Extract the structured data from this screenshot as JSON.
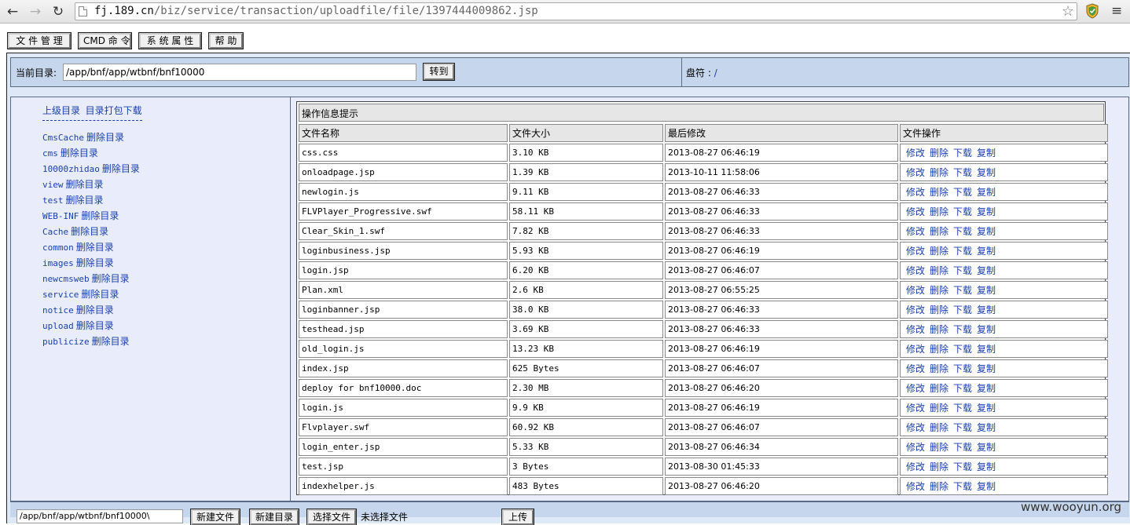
{
  "browser": {
    "url_host": "fj.189.cn",
    "url_path": "/biz/service/transaction/uploadfile/file/1397444009862.jsp",
    "icons": [
      "back-icon",
      "forward-icon",
      "reload-icon",
      "page-icon",
      "star-icon",
      "shield-icon",
      "menu-icon"
    ]
  },
  "top_menu": {
    "file_manage": "文 件 管 理",
    "cmd": "CMD 命 令",
    "sys_attr": "系 统 属 性",
    "help": "帮 助"
  },
  "dir_bar": {
    "current_dir_label": "当前目录:",
    "current_dir_value": "/app/bnf/app/wtbnf/bnf10000",
    "goto_label": "转到",
    "drive_label": "盘符 :",
    "drive_link": "/"
  },
  "left": {
    "parent_dir": "上级目录",
    "pack_download": "目录打包下载",
    "delete_dir_label": "删除目录",
    "dirs": [
      "CmsCache",
      "cms",
      "10000zhidao",
      "view",
      "test",
      "WEB-INF",
      "Cache",
      "common",
      "images",
      "newcmsweb",
      "service",
      "notice",
      "upload",
      "publicize"
    ]
  },
  "table": {
    "info_title": "操作信息提示",
    "headers": [
      "文件名称",
      "文件大小",
      "最后修改",
      "文件操作"
    ],
    "ops": [
      "修改",
      "删除",
      "下载",
      "复制"
    ],
    "rows": [
      [
        "css.css",
        "3.10 KB",
        "2013-08-27 06:46:19"
      ],
      [
        "onloadpage.jsp",
        "1.39 KB",
        "2013-10-11 11:58:06"
      ],
      [
        "newlogin.js",
        "9.11 KB",
        "2013-08-27 06:46:33"
      ],
      [
        "FLVPlayer_Progressive.swf",
        "58.11 KB",
        "2013-08-27 06:46:33"
      ],
      [
        "Clear_Skin_1.swf",
        "7.82 KB",
        "2013-08-27 06:46:33"
      ],
      [
        "loginbusiness.jsp",
        "5.93 KB",
        "2013-08-27 06:46:19"
      ],
      [
        "login.jsp",
        "6.20 KB",
        "2013-08-27 06:46:07"
      ],
      [
        "Plan.xml",
        "2.6 KB",
        "2013-08-27 06:55:25"
      ],
      [
        "loginbanner.jsp",
        "38.0 KB",
        "2013-08-27 06:46:33"
      ],
      [
        "testhead.jsp",
        "3.69 KB",
        "2013-08-27 06:46:33"
      ],
      [
        "old_login.js",
        "13.23 KB",
        "2013-08-27 06:46:19"
      ],
      [
        "index.jsp",
        "625 Bytes",
        "2013-08-27 06:46:07"
      ],
      [
        "deploy for bnf10000.doc",
        "2.30 MB",
        "2013-08-27 06:46:20"
      ],
      [
        "login.js",
        "9.9 KB",
        "2013-08-27 06:46:19"
      ],
      [
        "Flvplayer.swf",
        "60.92 KB",
        "2013-08-27 06:46:07"
      ],
      [
        "login_enter.jsp",
        "5.33 KB",
        "2013-08-27 06:46:34"
      ],
      [
        "test.jsp",
        "3 Bytes",
        "2013-08-30 01:45:33"
      ],
      [
        "indexhelper.js",
        "483 Bytes",
        "2013-08-27 06:46:20"
      ]
    ]
  },
  "bottom": {
    "path_value": "/app/bnf/app/wtbnf/bnf10000\\",
    "new_file": "新建文件",
    "new_dir": "新建目录",
    "choose_file": "选择文件",
    "no_file": "未选择文件",
    "upload": "上传"
  },
  "watermark": "www.wooyun.org"
}
